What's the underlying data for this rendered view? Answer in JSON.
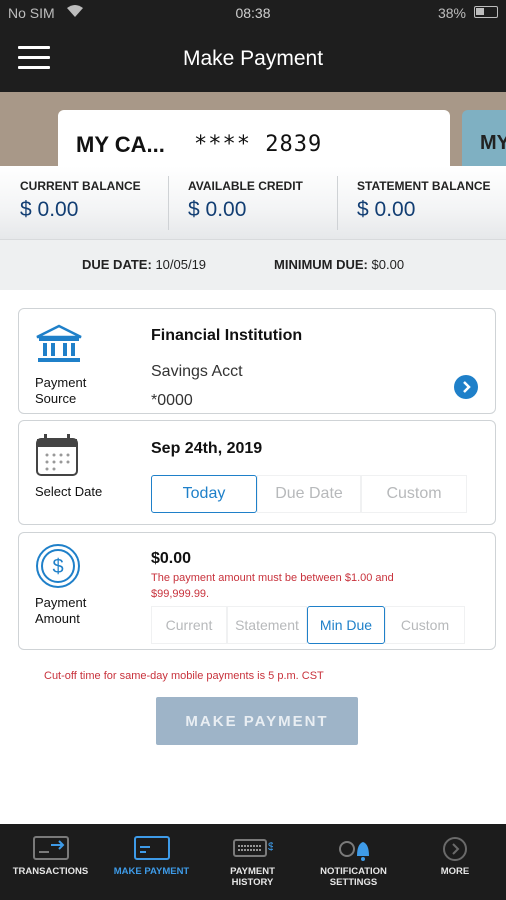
{
  "status_bar": {
    "carrier": "No SIM",
    "time": "08:38",
    "battery": "38%"
  },
  "nav": {
    "title": "Make Payment"
  },
  "cards": {
    "main_name": "MY CA...",
    "main_number": "**** 2839",
    "next_name": "MY"
  },
  "balances": [
    {
      "title": "CURRENT BALANCE",
      "value": "$ 0.00"
    },
    {
      "title": "AVAILABLE CREDIT",
      "value": "$ 0.00"
    },
    {
      "title": "STATEMENT BALANCE",
      "value": "$ 0.00"
    }
  ],
  "due": {
    "date_label": "DUE DATE:",
    "date_value": "10/05/19",
    "min_label": "MINIMUM DUE:",
    "min_value": "$0.00"
  },
  "source": {
    "label_line1": "Payment",
    "label_line2": "Source",
    "institution": "Financial Institution",
    "account": "Savings Acct",
    "account_number": "*0000"
  },
  "date": {
    "label": "Select Date",
    "value": "Sep 24th, 2019",
    "options": [
      "Today",
      "Due Date",
      "Custom"
    ],
    "selected": "Today"
  },
  "amount": {
    "label_line1": "Payment",
    "label_line2": "Amount",
    "value": "$0.00",
    "error_line1": "The payment amount must be between $1.00 and",
    "error_line2": "$99,999.99.",
    "options": [
      "Current",
      "Statement",
      "Min Due",
      "Custom"
    ],
    "selected": "Min Due"
  },
  "cutoff_notice": "Cut-off time for same-day mobile payments is 5 p.m. CST",
  "make_payment_button": "MAKE PAYMENT",
  "tabs": [
    {
      "line1": "TRANSACTIONS",
      "line2": ""
    },
    {
      "line1": "MAKE PAYMENT",
      "line2": ""
    },
    {
      "line1": "PAYMENT",
      "line2": "HISTORY"
    },
    {
      "line1": "NOTIFICATION",
      "line2": "SETTINGS"
    },
    {
      "line1": "MORE",
      "line2": ""
    }
  ],
  "colors": {
    "accent": "#1f80c9",
    "navy": "#123e73",
    "error": "#c8323c",
    "button_disabled": "#9eb4c8",
    "active_tab": "#3e9be8"
  }
}
